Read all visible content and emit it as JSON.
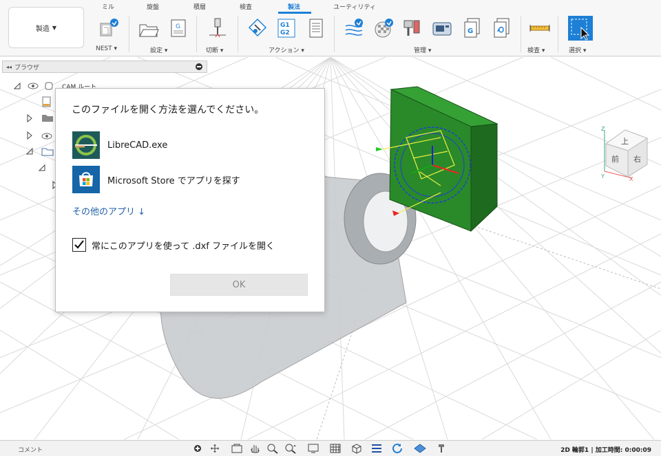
{
  "ribbon": {
    "tabs": [
      {
        "label": "ミル",
        "active": false
      },
      {
        "label": "旋盤",
        "active": false
      },
      {
        "label": "積層",
        "active": false
      },
      {
        "label": "検査",
        "active": false
      },
      {
        "label": "製法",
        "active": true
      },
      {
        "label": "ユーティリティ",
        "active": false
      }
    ],
    "workspace_label": "製造",
    "groups": [
      {
        "label": "NEST"
      },
      {
        "label": "設定"
      },
      {
        "label": "切断"
      },
      {
        "label": "アクション"
      },
      {
        "label": "管理"
      },
      {
        "label": "検査"
      },
      {
        "label": "選択"
      }
    ]
  },
  "browser": {
    "header_label": "ブラウザ",
    "tree": [
      {
        "label": "CAM ルート"
      }
    ]
  },
  "dialog": {
    "title": "このファイルを開く方法を選んでください。",
    "apps": [
      {
        "name": "LibreCAD.exe",
        "icon": "librecad-icon"
      },
      {
        "name": "Microsoft Store でアプリを探す",
        "icon": "microsoft-store-icon"
      }
    ],
    "more_apps_label": "その他のアプリ ↓",
    "always_use_label": "常にこのアプリを使って .dxf ファイルを開く",
    "always_use_checked": true,
    "ok_label": "OK"
  },
  "viewcube": {
    "top_label": "上",
    "front_label": "前",
    "right_label": "右",
    "axis_z": "Z",
    "axis_x": "X",
    "axis_y": "Y"
  },
  "statusbar": {
    "comment_label": "コメント",
    "status_text": "2D 輪郭1 | 加工時間: 0:00:09"
  },
  "colors": {
    "accent": "#1d7fd6",
    "part_green": "#1f7f1f",
    "link_blue": "#1f5fa8"
  }
}
